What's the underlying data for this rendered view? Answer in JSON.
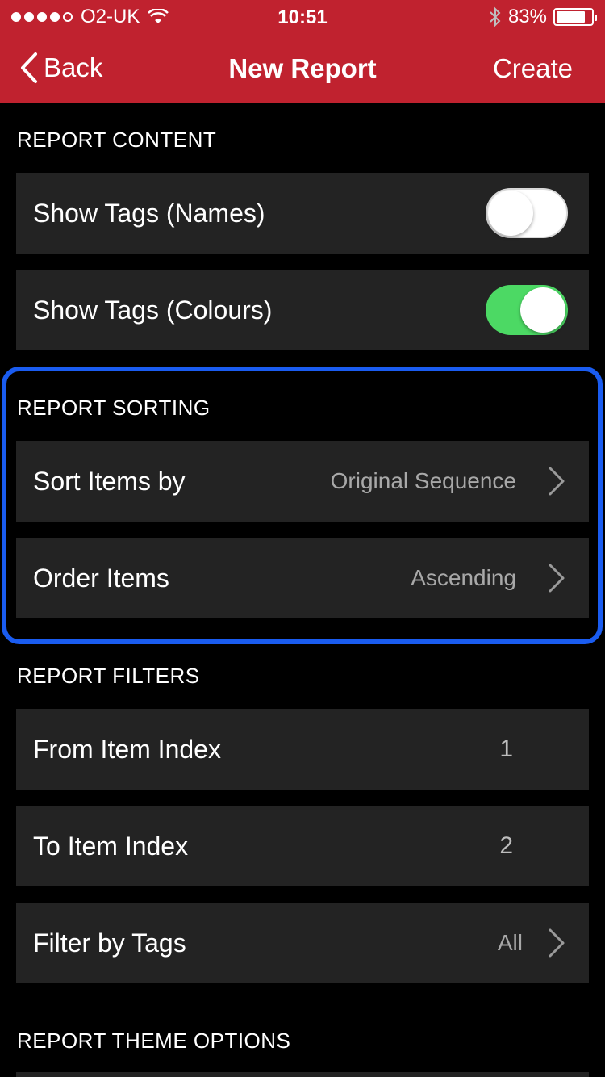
{
  "status_bar": {
    "carrier": "O2-UK",
    "time": "10:51",
    "battery_percent": "83%",
    "battery_level": 0.83,
    "signal_bars": 4,
    "signal_total": 5
  },
  "nav": {
    "back_label": "Back",
    "title": "New Report",
    "create_label": "Create",
    "bar_color": "#c0222f"
  },
  "sections": {
    "content": {
      "header": "REPORT CONTENT",
      "rows": [
        {
          "label": "Show Tags (Names)",
          "toggle": false
        },
        {
          "label": "Show Tags (Colours)",
          "toggle": true
        }
      ]
    },
    "sorting": {
      "header": "REPORT SORTING",
      "rows": [
        {
          "label": "Sort Items by",
          "value": "Original Sequence"
        },
        {
          "label": "Order Items",
          "value": "Ascending"
        }
      ]
    },
    "filters": {
      "header": "REPORT FILTERS",
      "rows": [
        {
          "label": "From Item Index",
          "value": "1"
        },
        {
          "label": "To Item Index",
          "value": "2"
        },
        {
          "label": "Filter by Tags",
          "value": "All"
        }
      ]
    },
    "theme": {
      "header": "REPORT THEME OPTIONS"
    }
  },
  "colors": {
    "highlight": "#1a5cf0",
    "toggle_on": "#4cd964",
    "row_bg": "#232323"
  },
  "icons": {
    "back": "chevron-left-icon",
    "disclosure": "chevron-right-icon",
    "wifi": "wifi-icon",
    "bluetooth": "bluetooth-icon",
    "battery": "battery-icon"
  }
}
